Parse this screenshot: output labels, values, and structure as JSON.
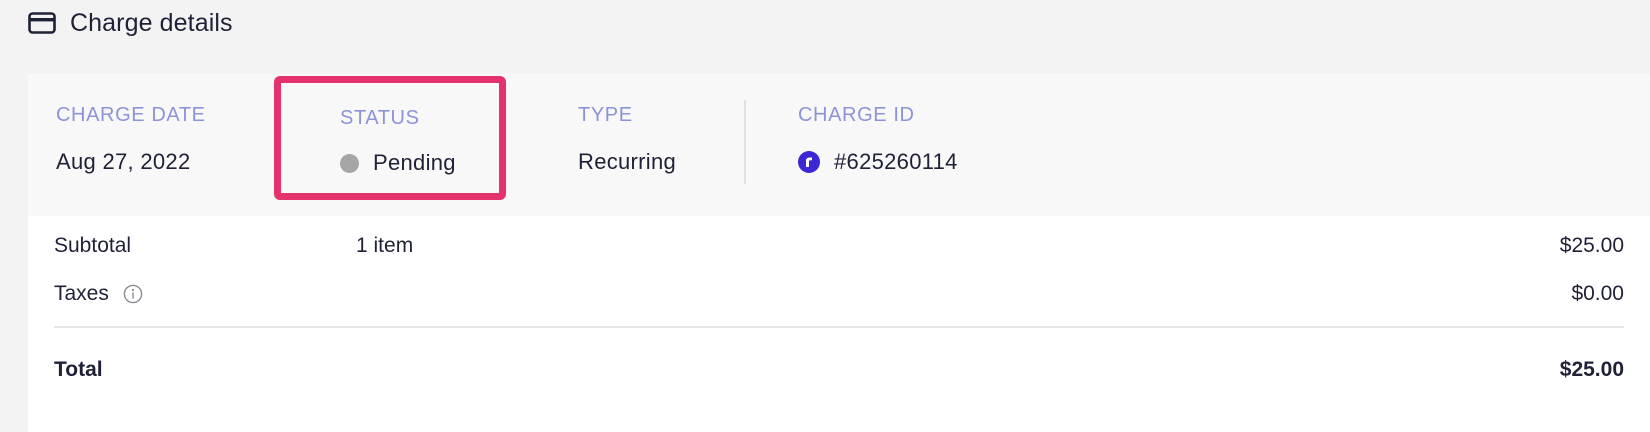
{
  "header": {
    "icon": "credit-card-icon",
    "title": "Charge details"
  },
  "meta": {
    "charge_date": {
      "label": "CHARGE DATE",
      "value": "Aug 27, 2022"
    },
    "status": {
      "label": "STATUS",
      "value": "Pending",
      "dot_color": "#a6a6a6"
    },
    "type": {
      "label": "TYPE",
      "value": "Recurring"
    },
    "charge_id": {
      "label": "CHARGE ID",
      "value": "#625260114",
      "badge_icon": "recharge-logo-icon",
      "badge_color": "#3b28d4"
    }
  },
  "highlight_color": "#e4326d",
  "summary": {
    "subtotal": {
      "label": "Subtotal",
      "items": "1 item",
      "amount": "$25.00"
    },
    "taxes": {
      "label": "Taxes",
      "icon": "info-icon",
      "amount": "$0.00"
    },
    "total": {
      "label": "Total",
      "amount": "$25.00"
    }
  }
}
